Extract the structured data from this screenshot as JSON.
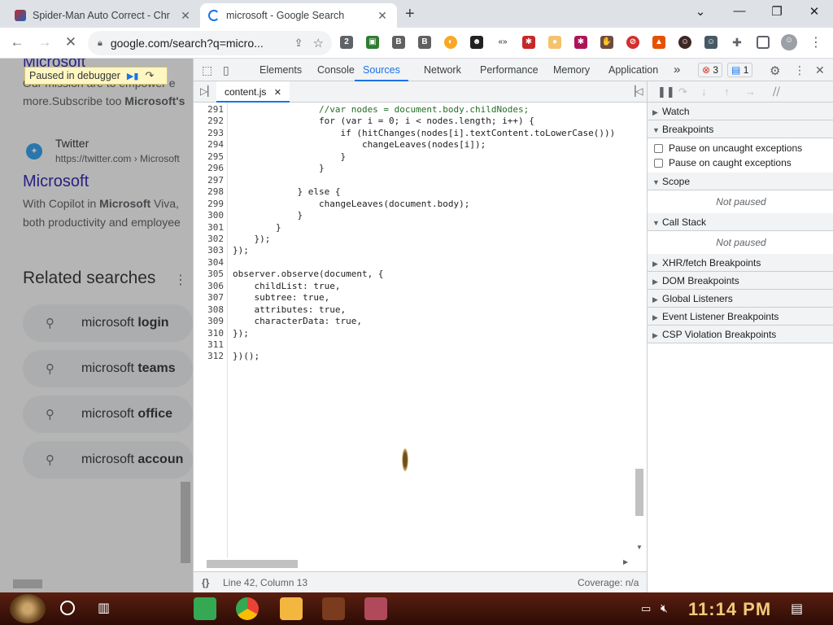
{
  "browser": {
    "tabs": [
      {
        "title": "Spider-Man Auto Correct - Chr",
        "active": false
      },
      {
        "title": "microsoft - Google Search",
        "active": true
      }
    ],
    "url": "google.com/search?q=micro...",
    "new_tab_symbol": "+"
  },
  "page": {
    "paused_label": "Paused in debugger",
    "result1_title": "Microsoft",
    "result1_snippet_a": "Our mission are to empower e",
    "result1_snippet_b_pre": "more.Subscribe too ",
    "result1_snippet_b_bold": "Microsoft's",
    "twitter_name": "Twitter",
    "twitter_url": "https://twitter.com › Microsoft",
    "result2_title": "Microsoft",
    "result2_snippet_a_pre": "With Copilot in ",
    "result2_snippet_a_bold": "Microsoft",
    "result2_snippet_a_post": " Viva,",
    "result2_snippet_b": "both productivity and employee",
    "related_heading": "Related searches",
    "related": [
      {
        "pre": "microsoft ",
        "bold": "login"
      },
      {
        "pre": "microsoft ",
        "bold": "teams"
      },
      {
        "pre": "microsoft ",
        "bold": "office"
      },
      {
        "pre": "microsoft ",
        "bold": "accoun"
      }
    ]
  },
  "devtools": {
    "tabs": [
      "Elements",
      "Console",
      "Sources",
      "Network",
      "Performance",
      "Memory",
      "Application"
    ],
    "selected_tab": "Sources",
    "more_tabs": "»",
    "errors_count": "3",
    "messages_count": "1",
    "file_name": "content.js",
    "code": [
      {
        "n": "291",
        "text": "                //var nodes = document.body.childNodes;",
        "cls": "cm"
      },
      {
        "n": "292",
        "text": "                for (var i = 0; i < nodes.length; i++) {",
        "cls": ""
      },
      {
        "n": "293",
        "text": "                    if (hitChanges(nodes[i].textContent.toLowerCase()))",
        "cls": ""
      },
      {
        "n": "294",
        "text": "                        changeLeaves(nodes[i]);",
        "cls": ""
      },
      {
        "n": "295",
        "text": "                    }",
        "cls": ""
      },
      {
        "n": "296",
        "text": "                }",
        "cls": ""
      },
      {
        "n": "297",
        "text": "",
        "cls": ""
      },
      {
        "n": "298",
        "text": "            } else {",
        "cls": ""
      },
      {
        "n": "299",
        "text": "                changeLeaves(document.body);",
        "cls": ""
      },
      {
        "n": "300",
        "text": "            }",
        "cls": ""
      },
      {
        "n": "301",
        "text": "        }",
        "cls": ""
      },
      {
        "n": "302",
        "text": "    });",
        "cls": ""
      },
      {
        "n": "303",
        "text": "});",
        "cls": ""
      },
      {
        "n": "304",
        "text": "",
        "cls": ""
      },
      {
        "n": "305",
        "text": "observer.observe(document, {",
        "cls": ""
      },
      {
        "n": "306",
        "text": "    childList: true,",
        "cls": ""
      },
      {
        "n": "307",
        "text": "    subtree: true,",
        "cls": ""
      },
      {
        "n": "308",
        "text": "    attributes: true,",
        "cls": ""
      },
      {
        "n": "309",
        "text": "    characterData: true,",
        "cls": ""
      },
      {
        "n": "310",
        "text": "});",
        "cls": ""
      },
      {
        "n": "311",
        "text": "",
        "cls": ""
      },
      {
        "n": "312",
        "text": "})();",
        "cls": ""
      }
    ],
    "status_position": "Line 42, Column 13",
    "status_coverage": "Coverage: n/a",
    "status_braces": "{}",
    "debugger": {
      "watch": "Watch",
      "breakpoints": "Breakpoints",
      "pause_uncaught": "Pause on uncaught exceptions",
      "pause_caught": "Pause on caught exceptions",
      "scope": "Scope",
      "not_paused": "Not paused",
      "call_stack": "Call Stack",
      "not_paused_2": "Not paused",
      "xhr": "XHR/fetch Breakpoints",
      "dom": "DOM Breakpoints",
      "global": "Global Listeners",
      "event": "Event Listener Breakpoints",
      "csp": "CSP Violation Breakpoints"
    }
  },
  "taskbar": {
    "clock": "11:14 PM"
  }
}
